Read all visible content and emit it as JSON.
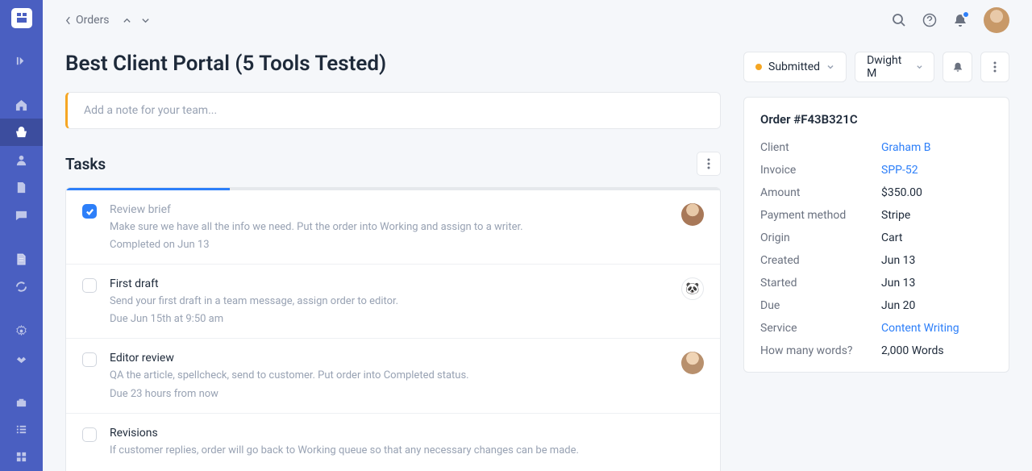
{
  "breadcrumb": "Orders",
  "page_title": "Best Client Portal (5 Tools Tested)",
  "note_placeholder": "Add a note for your team...",
  "tasks_heading": "Tasks",
  "progress_pct": 25,
  "tasks": [
    {
      "done": true,
      "title": "Review brief",
      "desc": "Make sure we have all the info we need. Put the order into Working and assign to a writer.",
      "meta": "Completed on Jun 13",
      "avatar": "av1"
    },
    {
      "done": false,
      "title": "First draft",
      "desc": "Send your first draft in a team message, assign order to editor.",
      "meta": "Due Jun 15th at 9:50 am",
      "avatar": "av2"
    },
    {
      "done": false,
      "title": "Editor review",
      "desc": "QA the article, spellcheck, send to customer. Put order into Completed status.",
      "meta": "Due 23 hours from now",
      "avatar": "av3"
    },
    {
      "done": false,
      "title": "Revisions",
      "desc": "If customer replies, order will go back to Working queue so that any necessary changes can be made.",
      "meta": "",
      "avatar": ""
    }
  ],
  "status": "Submitted",
  "assignee": "Dwight M",
  "order_header": "Order #F43B321C",
  "details": [
    {
      "label": "Client",
      "value": "Graham B",
      "link": true
    },
    {
      "label": "Invoice",
      "value": "SPP-52",
      "link": true
    },
    {
      "label": "Amount",
      "value": "$350.00",
      "link": false
    },
    {
      "label": "Payment method",
      "value": "Stripe",
      "link": false
    },
    {
      "label": "Origin",
      "value": "Cart",
      "link": false
    },
    {
      "label": "Created",
      "value": "Jun 13",
      "link": false
    },
    {
      "label": "Started",
      "value": "Jun 13",
      "link": false
    },
    {
      "label": "Due",
      "value": "Jun 20",
      "link": false
    },
    {
      "label": "Service",
      "value": "Content Writing",
      "link": true
    },
    {
      "label": "How many words?",
      "value": "2,000 Words",
      "link": false
    }
  ]
}
